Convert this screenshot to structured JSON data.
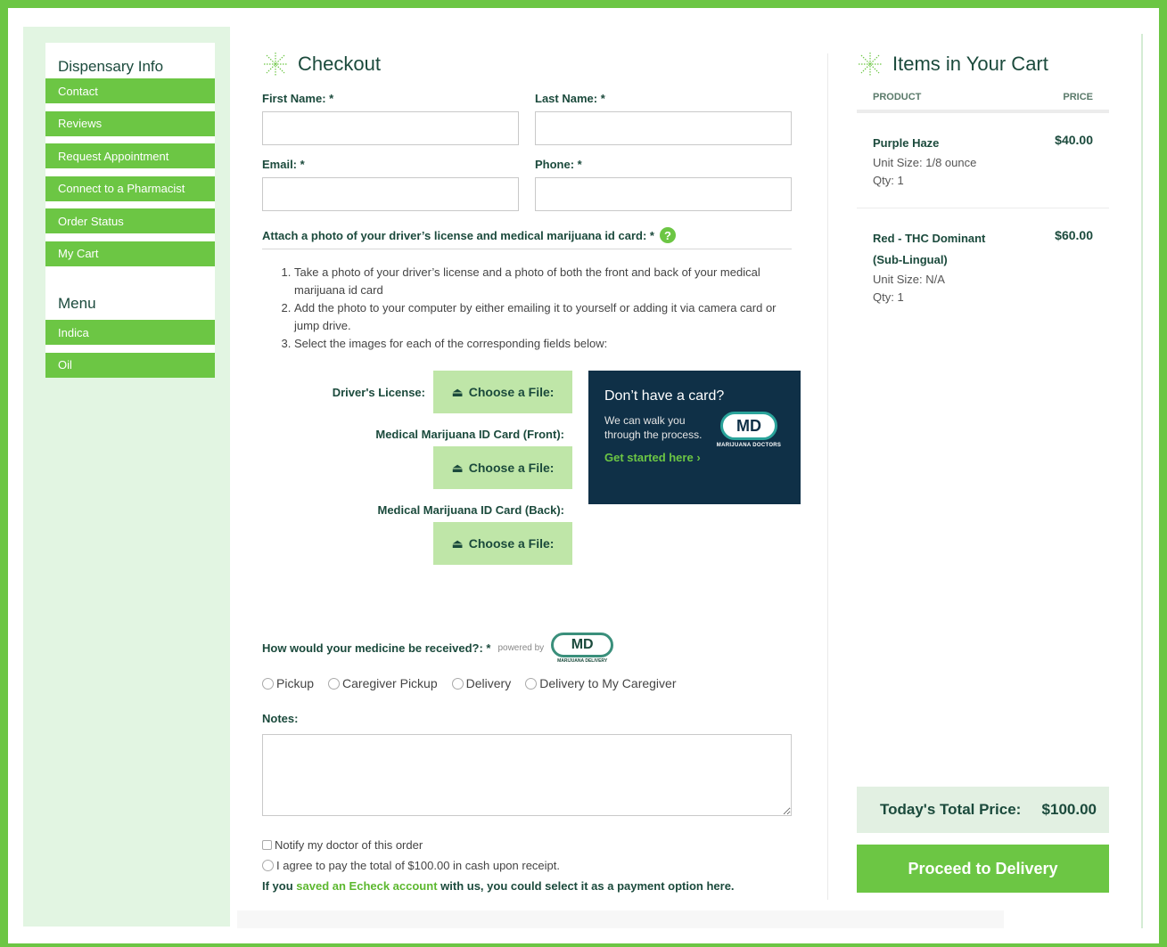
{
  "sidebar": {
    "info_heading": "Dispensary Info",
    "info_items": [
      {
        "label": "Contact"
      },
      {
        "label": "Reviews"
      },
      {
        "label": "Request Appointment"
      },
      {
        "label": "Connect to a Pharmacist"
      },
      {
        "label": "Order Status"
      },
      {
        "label": "My Cart"
      }
    ],
    "menu_heading": "Menu",
    "menu_items": [
      {
        "label": "Indica"
      },
      {
        "label": "Oil"
      }
    ]
  },
  "checkout": {
    "title": "Checkout",
    "first_name_label": "First Name: *",
    "last_name_label": "Last Name: *",
    "email_label": "Email: *",
    "phone_label": "Phone: *",
    "first_name_value": "",
    "last_name_value": "",
    "email_value": "",
    "phone_value": "",
    "attach_title": "Attach a photo of your driver’s license and medical marijuana id card: *",
    "steps": [
      "Take a photo of your driver’s license and a photo of both the front and back of your medical marijuana id card",
      "Add the photo to your computer by either emailing it to yourself or adding it via camera card or jump drive.",
      "Select the images for each of the corresponding fields below:"
    ],
    "uploads": {
      "drivers_license_label": "Driver's License:",
      "id_front_label": "Medical Marijuana ID Card (Front):",
      "id_back_label": "Medical Marijuana ID Card (Back):",
      "choose_file_label": "Choose a File:"
    },
    "promo": {
      "title": "Don’t have a card?",
      "body": "We can walk you through the process.",
      "link": "Get started here",
      "logo_text": "MD",
      "logo_sub": "MARIJUANA DOCTORS"
    },
    "received_label": "How would your medicine be received?: *",
    "powered_by": "powered by",
    "delivery_logo_text": "MD",
    "delivery_logo_sub": "MARIJUANA DELIVERY",
    "receive_options": [
      "Pickup",
      "Caregiver Pickup",
      "Delivery",
      "Delivery to My Caregiver"
    ],
    "notes_label": "Notes:",
    "notes_value": "",
    "notify_doctor": "Notify my doctor of this order",
    "agree_pay": "I agree to pay the total of $100.00 in cash upon receipt.",
    "echeck_prefix": "If you ",
    "echeck_link": "saved an Echeck account",
    "echeck_suffix": " with us, you could select it as a payment option here."
  },
  "cart": {
    "title": "Items in Your Cart",
    "col_product": "PRODUCT",
    "col_price": "PRICE",
    "items": [
      {
        "name": "Purple Haze",
        "price": "$40.00",
        "unit": "Unit Size: 1/8 ounce",
        "qty": "Qty: 1"
      },
      {
        "name": "Red - THC Dominant (Sub-Lingual)",
        "price": "$60.00",
        "unit": "Unit Size: N/A",
        "qty": "Qty: 1"
      }
    ],
    "total_label": "Today's Total Price:",
    "total_value": "$100.00",
    "proceed_label": "Proceed to Delivery"
  },
  "colors": {
    "accent": "#6cc644",
    "dark_text": "#1b4a3c",
    "promo_bg": "#0f3047"
  }
}
